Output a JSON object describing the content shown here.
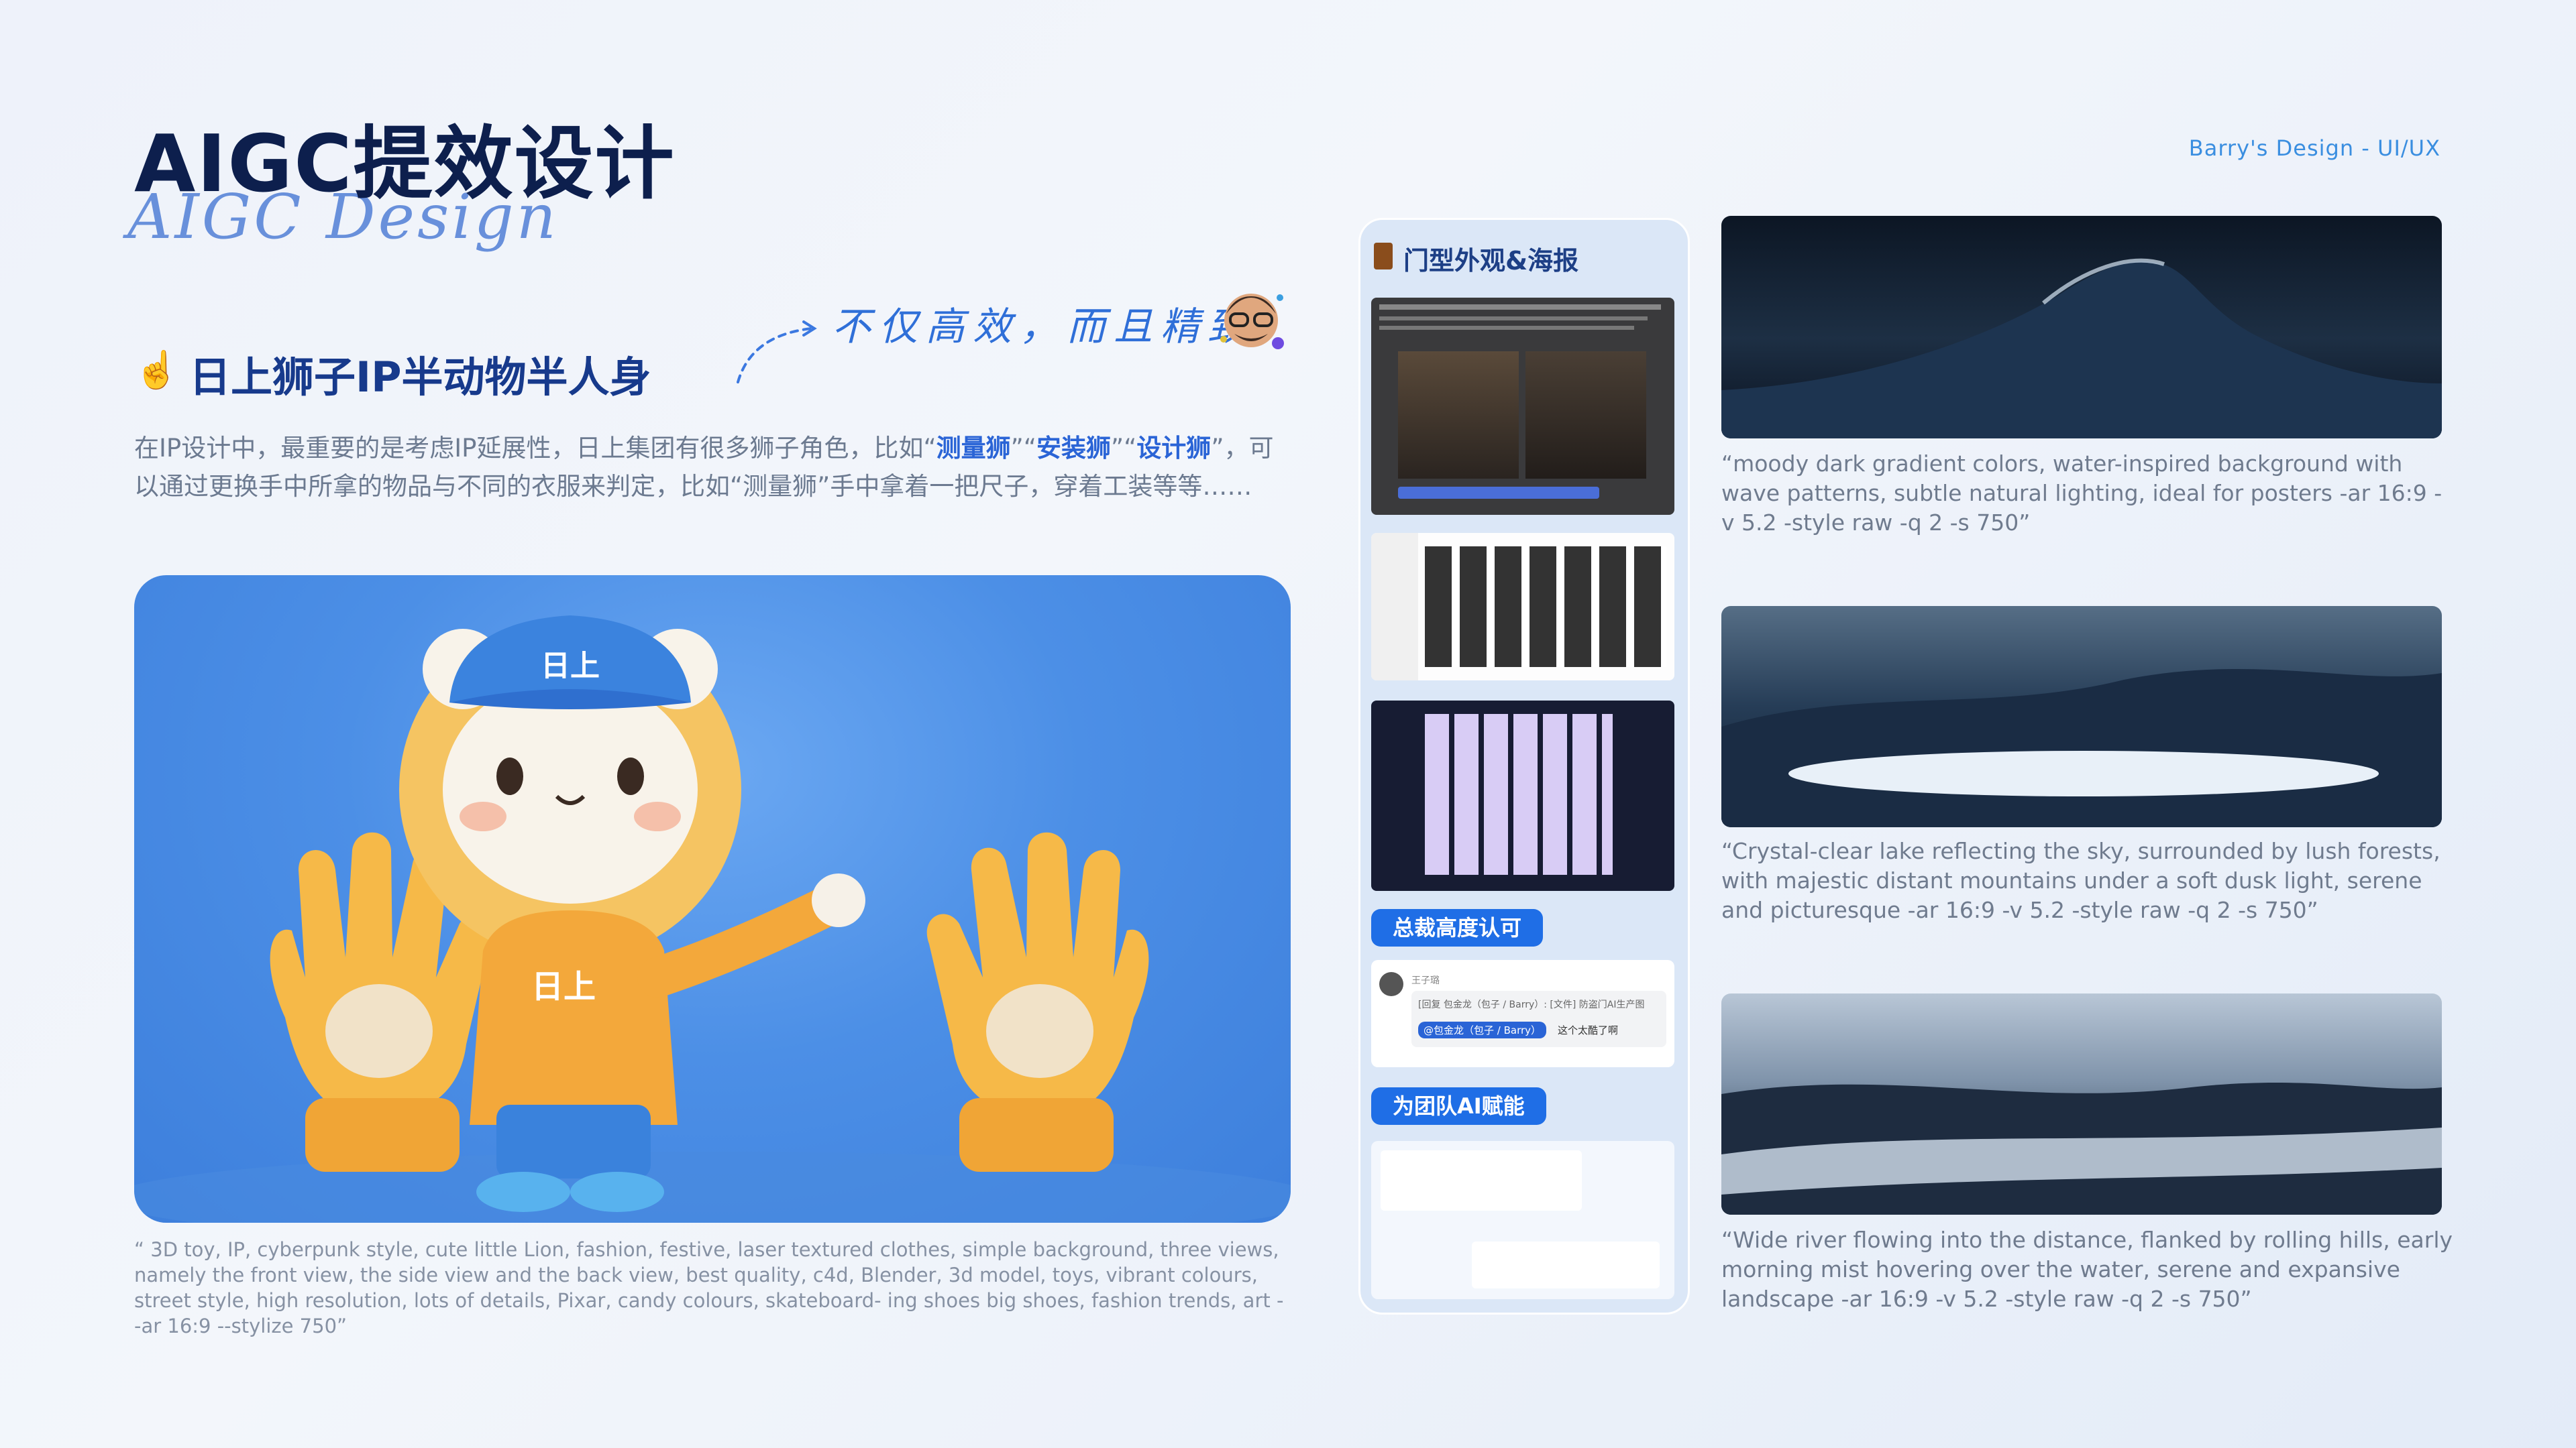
{
  "header": {
    "title": "AIGC提效设计",
    "script_subtitle": "AIGC Design",
    "brand": "Barry's Design - UI/UX"
  },
  "section": {
    "icon": "pointing-up-hand-icon",
    "title": "日上狮子IP半动物半人身",
    "handwriting": "不仅高效，而且精致"
  },
  "description": {
    "part1": "在IP设计中，最重要的是考虑IP延展性，日上集团有很多狮子角色，比如“",
    "hl1": "测量狮",
    "part2": "”“",
    "hl2": "安装狮",
    "part3": "”“",
    "hl3": "设计狮",
    "part4": "”，可以通过更换手中所拿的物品与不同的衣服来判定，比如“测量狮”手中拿着一把尺子，穿着工装等等……"
  },
  "mascot": {
    "cap_text": "日上",
    "shirt_text": "日上",
    "caption": "“ 3D toy, IP, cyberpunk style, cute little Lion, fashion, festive, laser textured clothes, simple background, three views, namely the front view, the side view and the back view, best quality, c4d, Blender, 3d model, toys, vibrant colours, street style, high resolution, lots of details, Pixar, candy colours, skateboard- ing shoes big shoes, fashion trends, art --ar 16:9 --stylize 750”"
  },
  "panel": {
    "title": "门型外观&海报",
    "badge1": "总裁高度认可",
    "badge2": "为团队AI赋能",
    "chat1": {
      "name": "王子璐",
      "quote": "[回复 包金龙（包子 / Barry）: [文件] 防盗门AI生产图",
      "mention": "@包金龙（包子 / Barry）",
      "message": "这个太酷了啊"
    }
  },
  "right": {
    "caption1": "“moody dark gradient colors, water-inspired background with wave patterns, subtle natural lighting, ideal for posters -ar 16:9 -v 5.2 -style raw -q 2 -s 750”",
    "caption2": "“Crystal-clear lake reflecting the sky, surrounded by lush forests, with majestic distant mountains under a soft dusk light, serene and picturesque -ar 16:9 -v 5.2 -style raw -q 2 -s 750”",
    "caption3": "“Wide river flowing into the distance, flanked by rolling hills, early morning mist hovering over the water, serene and expansive landscape -ar 16:9 -v 5.2 -style raw -q 2 -s 750”"
  },
  "colors": {
    "accent": "#2a64d6",
    "title": "#0d1f4d",
    "pill": "#1f6ee6",
    "mascot_bg": "#4c8fe6"
  }
}
